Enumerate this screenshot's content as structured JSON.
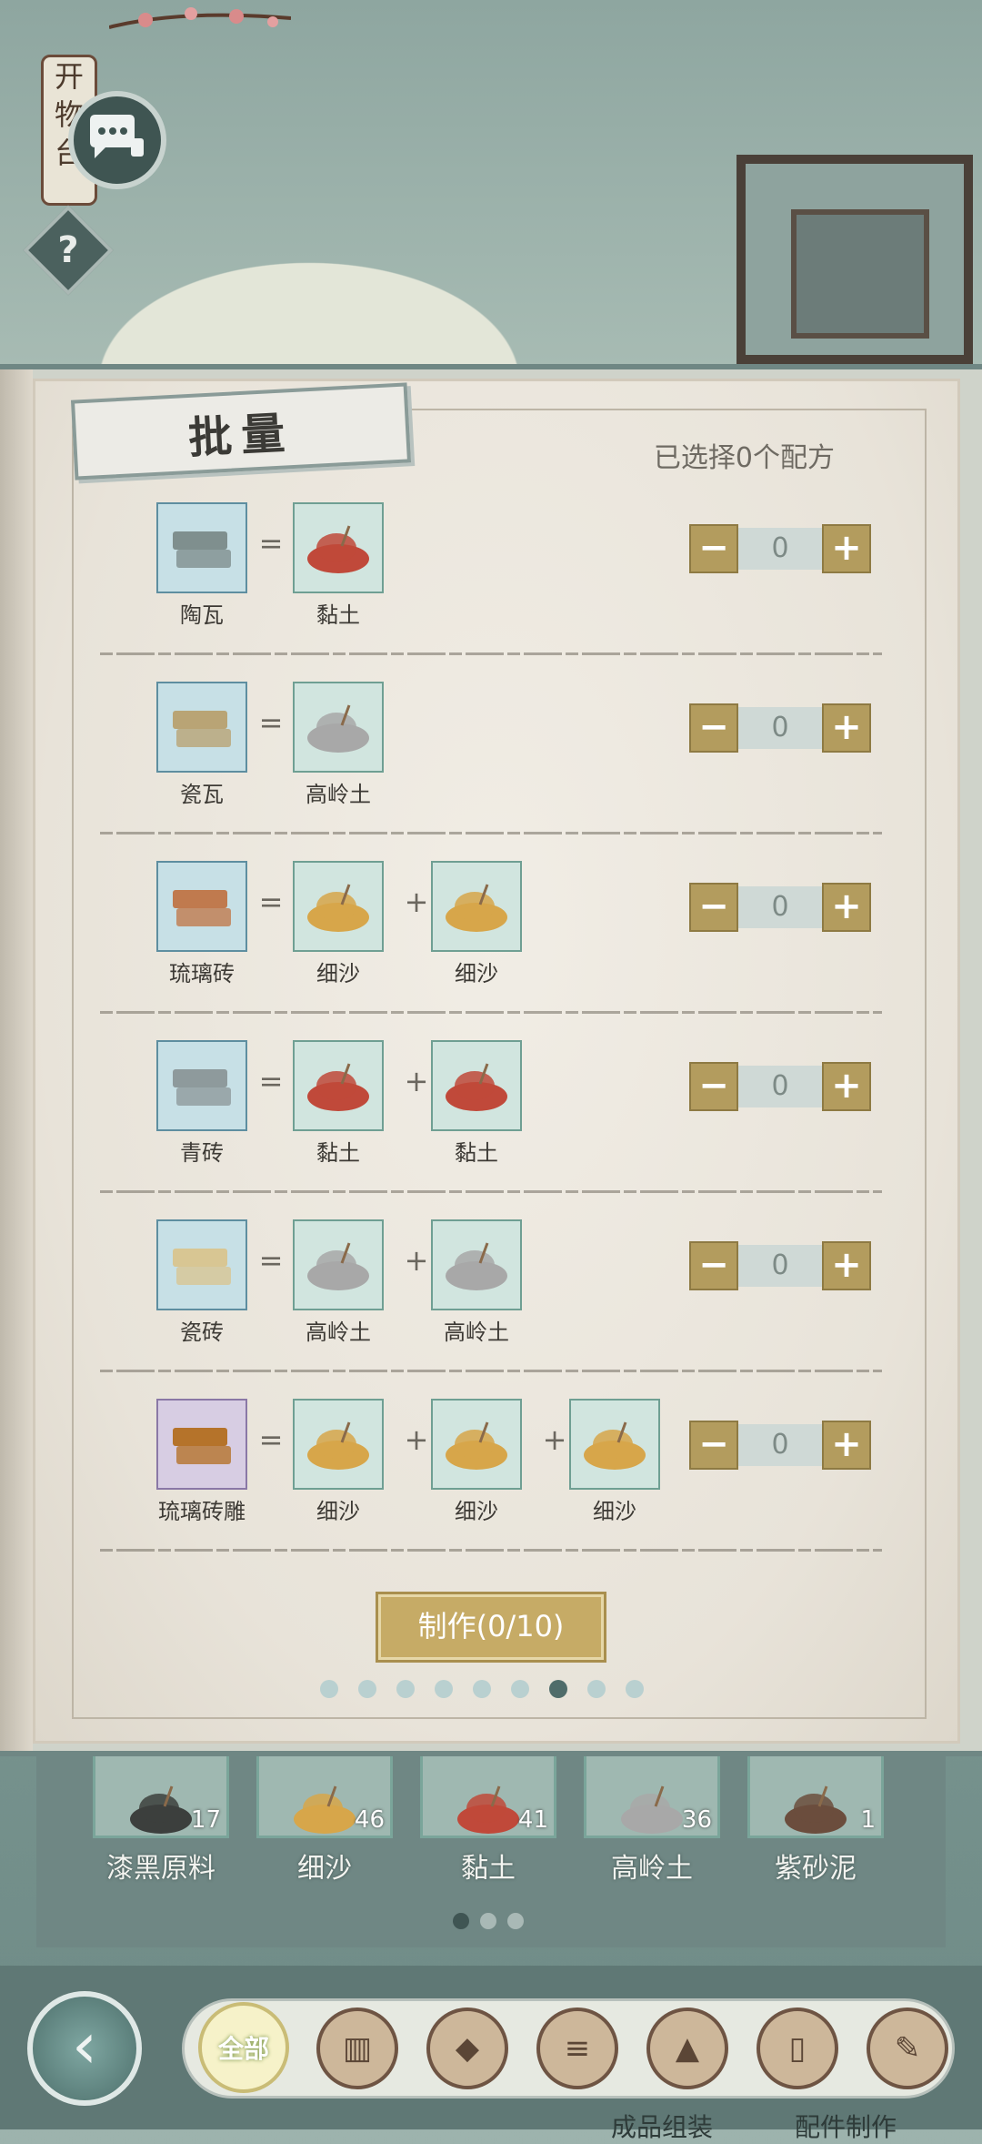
{
  "header": {
    "lantern_text": [
      "开",
      "物",
      "台"
    ],
    "help_label": "?"
  },
  "panel": {
    "title": "批量",
    "selected_status": "已选择0个配方",
    "make_button": "制作(0/10)",
    "page_dots": {
      "count": 9,
      "active": 7
    }
  },
  "recipes": [
    {
      "product": "陶瓦",
      "ingredients": [
        "黏土"
      ],
      "qty": "0"
    },
    {
      "product": "瓷瓦",
      "ingredients": [
        "高岭土"
      ],
      "qty": "0"
    },
    {
      "product": "琉璃砖",
      "ingredients": [
        "细沙",
        "细沙"
      ],
      "qty": "0"
    },
    {
      "product": "青砖",
      "ingredients": [
        "黏土",
        "黏土"
      ],
      "qty": "0"
    },
    {
      "product": "瓷砖",
      "ingredients": [
        "高岭土",
        "高岭土"
      ],
      "qty": "0"
    },
    {
      "product": "琉璃砖雕",
      "ingredients": [
        "细沙",
        "细沙",
        "细沙"
      ],
      "qty": "0"
    }
  ],
  "symbols": {
    "equals": "=",
    "plus": "+",
    "minus": "−",
    "plus_btn": "+"
  },
  "inventory": [
    {
      "name": "漆黑原料",
      "count": "17"
    },
    {
      "name": "细沙",
      "count": "46"
    },
    {
      "name": "黏土",
      "count": "41"
    },
    {
      "name": "高岭土",
      "count": "36"
    },
    {
      "name": "紫砂泥",
      "count": "1"
    }
  ],
  "inventory_dots": {
    "count": 3,
    "active": 1
  },
  "bottom_bar": {
    "back_label": "‹",
    "tabs": [
      {
        "label": "全部",
        "icon": "all-icon"
      },
      {
        "label": "",
        "icon": "scroll-tile-icon"
      },
      {
        "label": "",
        "icon": "stone-icon"
      },
      {
        "label": "",
        "icon": "wood-logs-icon"
      },
      {
        "label": "",
        "icon": "soil-pile-icon"
      },
      {
        "label": "",
        "icon": "bamboo-cups-icon"
      },
      {
        "label": "",
        "icon": "paper-scroll-icon"
      }
    ],
    "hint_left": "成品组装",
    "hint_right": "配件制作"
  },
  "colors": {
    "clay": "#c0493a",
    "sand": "#d7a64a",
    "kaolin": "#a8a8a8",
    "button_gold": "#b39c5e",
    "active_dot": "#4f6c6a"
  }
}
